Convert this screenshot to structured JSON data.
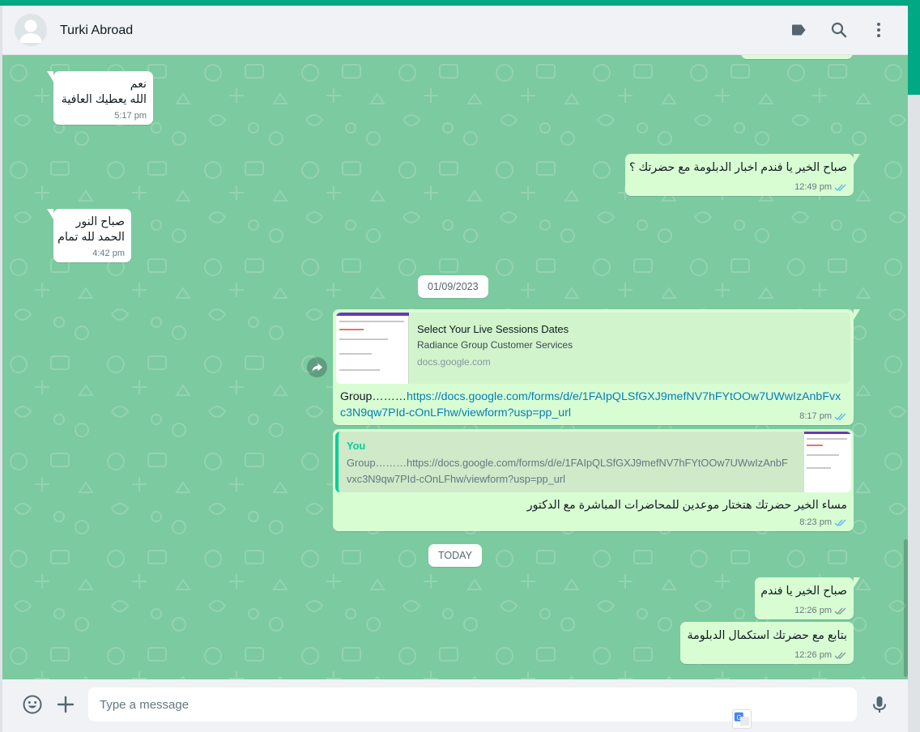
{
  "header": {
    "contact_name": "Turki Abroad",
    "icons": [
      "default-avatar-icon",
      "label-icon",
      "search-icon",
      "menu-icon"
    ]
  },
  "messages": [
    {
      "dir": "in",
      "lines": [
        "نعم",
        "الله يعطيك العافية"
      ],
      "time": "5:17 pm"
    },
    {
      "dir": "out",
      "text": "صباح الخير يا فندم اخبار الدبلومة مع حضرتك ؟",
      "time": "12:49 pm"
    },
    {
      "dir": "in",
      "lines": [
        "صباح النور",
        "الحمد لله تمام"
      ],
      "time": "4:42 pm"
    },
    {
      "dir": "out",
      "type": "link",
      "preview_title": "Select Your Live Sessions Dates",
      "preview_desc": "Radiance Group Customer Services",
      "preview_domain": "docs.google.com",
      "prefix": "Group………",
      "url": "https://docs.google.com/forms/d/e/1FAIpQLSfGXJ9mefNV7hFYtOOw7UWwIzAnbFvxc3N9qw7PId-cOnLFhw/viewform?usp=pp_url",
      "time": "8:17 pm"
    },
    {
      "dir": "out",
      "type": "reply",
      "quote_author": "You",
      "quote_text": "Group………https://docs.google.com/forms/d/e/1FAIpQLSfGXJ9mefNV7hFYtOOw7UWwIzAnbFvxc3N9qw7PId-cOnLFhw/viewform?usp=pp_url",
      "text": "مساء الخير حضرتك هتختار موعدين للمحاضرات المباشرة مع الدكتور",
      "time": "8:23 pm"
    },
    {
      "dir": "out",
      "text": "صباح الخير يا فندم",
      "time": "12:26 pm"
    },
    {
      "dir": "out",
      "text": "بتابع مع حضرتك استكمال الدبلومة",
      "time": "12:26 pm"
    }
  ],
  "date_separators": [
    "01/09/2023",
    "TODAY"
  ],
  "footer": {
    "placeholder": "Type a message",
    "icons": [
      "emoji-icon",
      "attach-plus-icon",
      "microphone-icon"
    ]
  },
  "colors": {
    "accent": "#00a884",
    "chat_background": "#7ccaa0",
    "incoming_bubble": "#ffffff",
    "outgoing_bubble": "#d9fdd3",
    "read_ticks": "#53bdeb",
    "link": "#027eb5"
  }
}
